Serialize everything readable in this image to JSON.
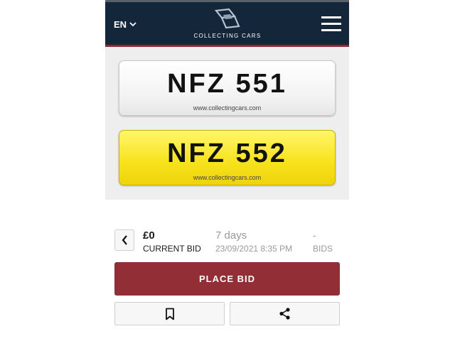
{
  "header": {
    "language": "EN",
    "brand": "COLLECTING CARS"
  },
  "gallery": {
    "plates": [
      {
        "number": "NFZ 551",
        "url": "www.collectingcars.com",
        "color": "#ffffff"
      },
      {
        "number": "NFZ 552",
        "url": "www.collectingcars.com",
        "color": "#f7e21b"
      }
    ]
  },
  "bid": {
    "amount": "£0",
    "amount_label": "CURRENT BID",
    "time_left": "7 days",
    "end_time": "23/09/2021 8:35 PM",
    "bids_count": "-",
    "bids_label": "BIDS"
  },
  "actions": {
    "place_bid": "PLACE BID",
    "icons": [
      "bookmark-icon",
      "share-icon"
    ]
  },
  "colors": {
    "header_bg": "#14263a",
    "accent": "#922e36",
    "yellow_plate": "#f7e21b"
  }
}
